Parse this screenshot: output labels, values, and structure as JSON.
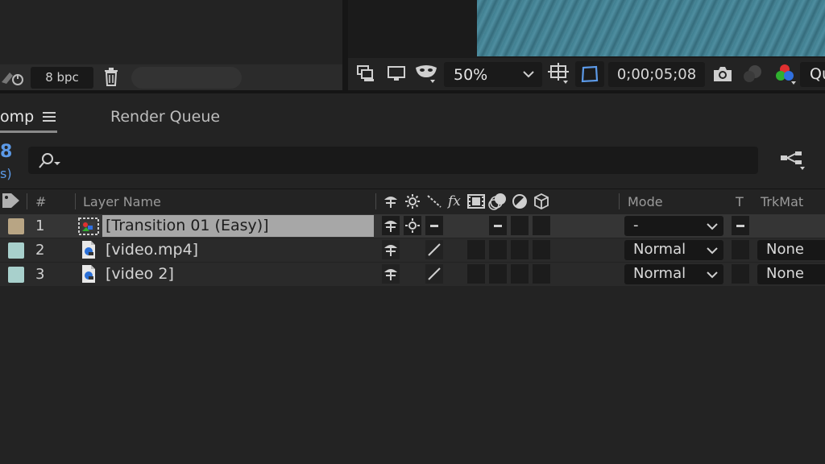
{
  "project_footer": {
    "bit_depth": "8 bpc"
  },
  "viewer_toolbar": {
    "zoom": "50%",
    "timecode": "0;00;05;08",
    "quality_partial": "Qu"
  },
  "tabs": [
    {
      "label": "omp",
      "active": true
    },
    {
      "label": "Render Queue",
      "active": false
    }
  ],
  "timeline": {
    "cti_frame_partial": "8",
    "cti_fps_partial": "s)",
    "search_placeholder": ""
  },
  "columns": {
    "num": "#",
    "layer_name": "Layer Name",
    "mode": "Mode",
    "t": "T",
    "trkmat": "TrkMat"
  },
  "layers": [
    {
      "num": "1",
      "name": "[Transition 01 (Easy)]",
      "label_color": "#b8a584",
      "mode": "-",
      "trkmat": "",
      "selected": true
    },
    {
      "num": "2",
      "name": "[video.mp4]",
      "label_color": "#a8d0cc",
      "mode": "Normal",
      "trkmat": "None",
      "selected": false
    },
    {
      "num": "3",
      "name": "[video 2]",
      "label_color": "#a8d0cc",
      "mode": "Normal",
      "trkmat": "None",
      "selected": false
    }
  ],
  "colors": {
    "accent_blue": "#5c9ae8",
    "panel_bg": "#232323"
  }
}
